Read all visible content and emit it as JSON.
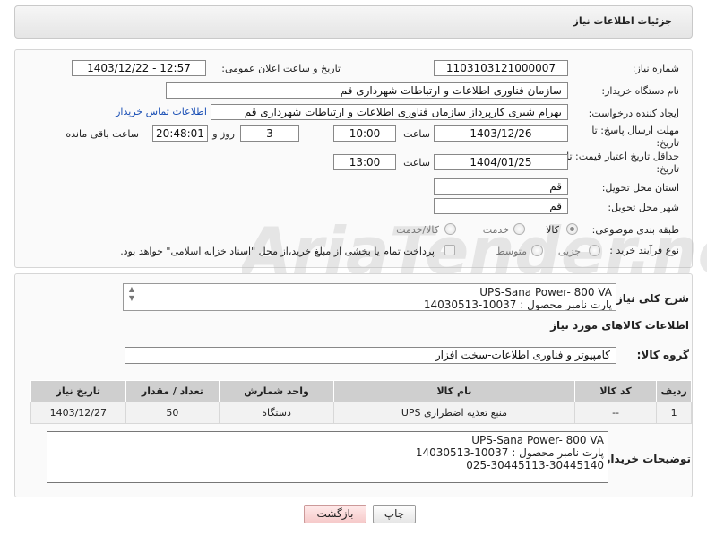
{
  "header": {
    "title": "جزئیات اطلاعات نیاز"
  },
  "form": {
    "need_number_label": "شماره نیاز:",
    "need_number": "1103103121000007",
    "announce_label": "تاریخ و ساعت اعلان عمومی:",
    "announce_value": "1403/12/22 - 12:57",
    "buyer_org_label": "نام دستگاه خریدار:",
    "buyer_org": "سازمان فناوری اطلاعات و ارتباطات شهرداری قم",
    "creator_label": "ایجاد کننده درخواست:",
    "creator": "بهرام شیری کارپرداز سازمان فناوری اطلاعات و ارتباطات شهرداری قم",
    "contact_link": "اطلاعات تماس خریدار",
    "reply_deadline_label": "مهلت ارسال پاسخ: تا تاریخ:",
    "reply_date": "1403/12/26",
    "time_label": "ساعت",
    "reply_time": "10:00",
    "days_value": "3",
    "days_and_label": "روز و",
    "remaining_time": "20:48:01",
    "remaining_label": "ساعت باقی مانده",
    "price_validity_label": "حداقل تاریخ اعتبار قیمت: تا تاریخ:",
    "price_date": "1404/01/25",
    "price_time": "13:00",
    "province_label": "استان محل تحویل:",
    "province": "قم",
    "city_label": "شهر محل تحویل:",
    "city": "قم",
    "category_label": "طبقه بندی موضوعی:",
    "category_options": [
      "کالا",
      "خدمت",
      "کالا/خدمت"
    ],
    "category_selected": "کالا",
    "process_label": "نوع فرآیند خرید :",
    "process_options": [
      "جزیی",
      "متوسط"
    ],
    "payment_note": "پرداخت تمام یا بخشی از مبلغ خرید،از محل \"اسناد خزانه اسلامی\" خواهد بود."
  },
  "details": {
    "summary_label": "شرح کلی نیاز:",
    "summary_line1": "UPS-Sana Power- 800 VA",
    "summary_line2": "پارت نامبر محصول : 10037-14030513",
    "goods_info_label": "اطلاعات کالاهای مورد نیاز",
    "group_label": "گروه کالا:",
    "group_value": "کامپیوتر و فناوری اطلاعات-سخت افزار",
    "table": {
      "headers": [
        "ردیف",
        "کد کالا",
        "نام کالا",
        "واحد شمارش",
        "تعداد / مقدار",
        "تاریخ نیاز"
      ],
      "rows": [
        [
          "1",
          "--",
          "منبع تغذیه اضطراری UPS",
          "دستگاه",
          "50",
          "1403/12/27"
        ]
      ]
    },
    "buyer_notes_label": "توضیحات خریدار:",
    "buyer_notes_line1": "UPS-Sana Power- 800 VA",
    "buyer_notes_line2": "پارت نامبر محصول : 10037-14030513",
    "buyer_notes_line3": "025-30445113-30445140"
  },
  "buttons": {
    "print": "چاپ",
    "back": "بازگشت"
  },
  "watermark": "AriaTender.neT"
}
